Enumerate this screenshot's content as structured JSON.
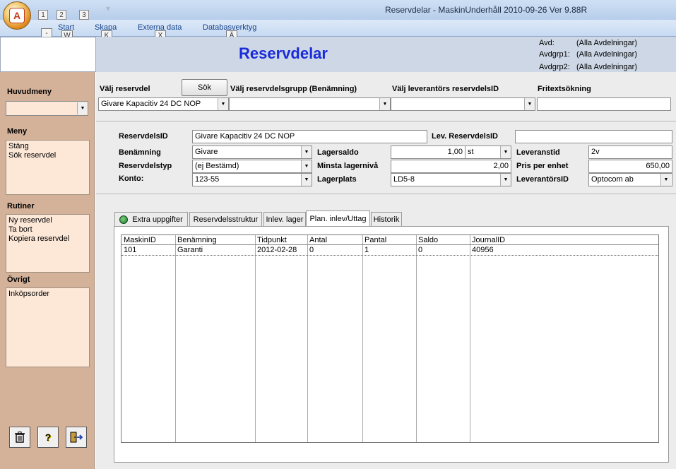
{
  "window": {
    "title": "Reservdelar - MaskinUnderhåll 2010-09-26  Ver 9.88R",
    "office_button_letter": "A",
    "qat_keytips": [
      "1",
      "2",
      "3"
    ]
  },
  "ribbon": {
    "tabs": [
      {
        "label": "Start",
        "keytip": "W"
      },
      {
        "label": "Skapa",
        "keytip": "K"
      },
      {
        "label": "Externa data",
        "keytip": "X"
      },
      {
        "label": "Databasverktyg",
        "keytip": "Ä"
      }
    ],
    "office_keytip": "-"
  },
  "header": {
    "title": "Reservdelar",
    "filters": [
      {
        "label": "Avd:",
        "value": "(Alla Avdelningar)"
      },
      {
        "label": "Avdgrp1:",
        "value": "(Alla Avdelningar)"
      },
      {
        "label": "Avdgrp2:",
        "value": "(Alla Avdelningar)"
      }
    ]
  },
  "sidebar": {
    "huvudmeny_label": "Huvudmeny",
    "huvudmeny_value": "",
    "meny_label": "Meny",
    "meny_items": [
      "Stäng",
      "Sök reservdel"
    ],
    "rutiner_label": "Rutiner",
    "rutiner_items": [
      "Ny reservdel",
      "Ta bort",
      "Kopiera reservdel"
    ],
    "ovrigt_label": "Övrigt",
    "ovrigt_items": [
      "Inköpsorder"
    ],
    "bottom_buttons": [
      {
        "name": "delete",
        "icon": "trash-icon"
      },
      {
        "name": "help",
        "icon": "question-icon"
      },
      {
        "name": "exit",
        "icon": "exit-door-icon"
      }
    ]
  },
  "search": {
    "valj_reservdel_label": "Välj reservdel",
    "sok_button": "Sök",
    "valj_grupp_label": "Välj reservdelsgrupp (Benämning)",
    "valj_leverantor_label": "Välj leverantörs reservdelsID",
    "fritext_label": "Fritextsökning",
    "valj_reservdel_value": "Givare Kapacitiv 24 DC NOP",
    "valj_grupp_value": "",
    "valj_leverantor_value": "",
    "fritext_value": ""
  },
  "form": {
    "reservdelsid_label": "ReservdelsID",
    "reservdelsid_value": "Givare Kapacitiv 24 DC NOP",
    "lev_reservdelsid_label": "Lev. ReservdelsID",
    "lev_reservdelsid_value": "",
    "benamning_label": "Benämning",
    "benamning_value": "Givare",
    "reservdelstyp_label": "Reservdelstyp",
    "reservdelstyp_value": "(ej Bestämd)",
    "konto_label": "Konto:",
    "konto_value": "123-55",
    "lagersaldo_label": "Lagersaldo",
    "lagersaldo_value": "1,00",
    "lagersaldo_unit": "st",
    "minsta_label": "Minsta lagernivå",
    "minsta_value": "2,00",
    "lagerplats_label": "Lagerplats",
    "lagerplats_value": "LD5-8",
    "leveranstid_label": "Leveranstid",
    "leveranstid_value": "2v",
    "pris_label": "Pris per enhet",
    "pris_value": "650,00",
    "leverantorsid_label": "LeverantörsID",
    "leverantorsid_value": "Optocom ab"
  },
  "tabs": [
    {
      "label": "Extra uppgifter",
      "active": false
    },
    {
      "label": "Reservdelsstruktur",
      "active": false
    },
    {
      "label": "Inlev. lager",
      "active": false
    },
    {
      "label": "Plan. inlev/Uttag",
      "active": true
    },
    {
      "label": "Historik",
      "active": false
    }
  ],
  "grid": {
    "columns": [
      "MaskinID",
      "Benämning",
      "Tidpunkt",
      "Antal",
      "Pantal",
      "Saldo",
      "JournalID"
    ],
    "rows": [
      [
        "101",
        "Garanti",
        "2012-02-28",
        "0",
        "1",
        "0",
        "40956"
      ]
    ]
  },
  "colors": {
    "title_blue": "#1a2bd9",
    "sidebar_bg": "#d4b29a",
    "sidebar_box": "#fde8d8",
    "header_bg": "#cdd7e6"
  }
}
